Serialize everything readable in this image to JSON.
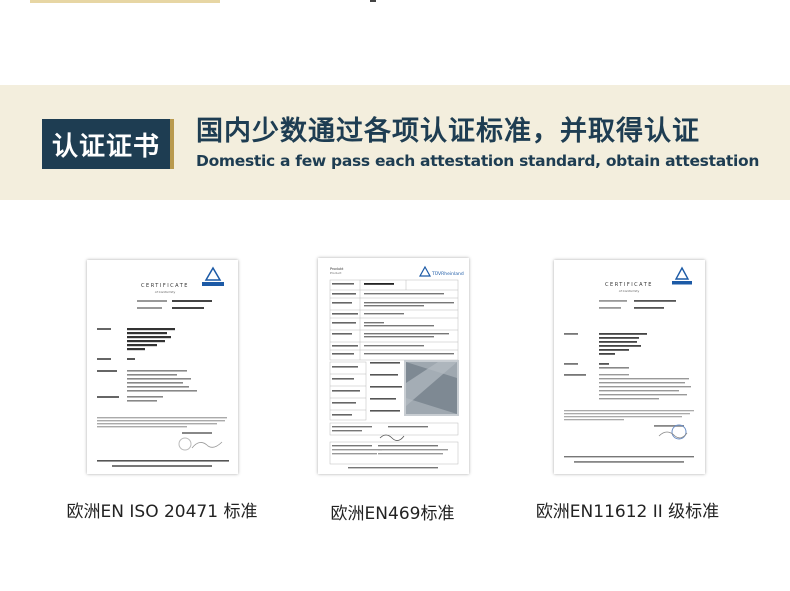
{
  "section": {
    "badge_label": "认证证书",
    "headline_cn": "国内少数通过各项认证标准，并取得认证",
    "headline_en": "Domestic a few pass each attestation standard, obtain attestation"
  },
  "certificates": [
    {
      "caption": "欧洲EN ISO 20471 标准",
      "heading": "CERTIFICATE",
      "subheading": "of Conformity",
      "logo_text": "TÜVRheinland"
    },
    {
      "caption": "欧洲EN469标准",
      "heading": "Produkt",
      "subheading": "Product",
      "logo_text": "TÜVRheinland"
    },
    {
      "caption": "欧洲EN11612  II 级标准",
      "heading": "CERTIFICATE",
      "subheading": "of Conformity",
      "logo_text": "TÜVRheinland"
    }
  ],
  "colors": {
    "navy": "#1e3d52",
    "banner_bg": "#f3eedd",
    "accent_gold": "#b99a4e",
    "tuv_blue": "#1c5aa6"
  }
}
